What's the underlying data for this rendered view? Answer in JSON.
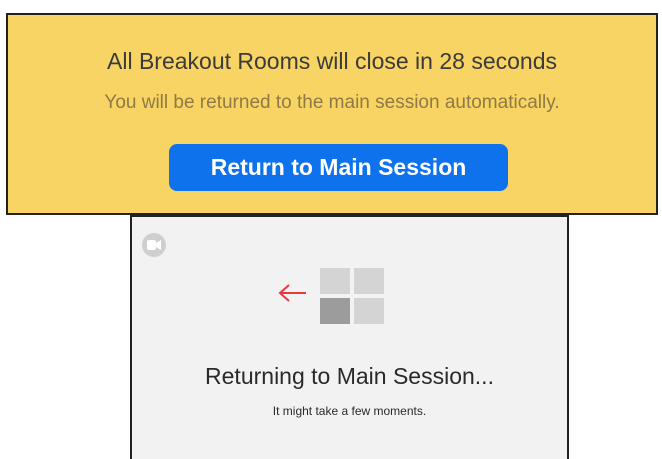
{
  "banner": {
    "title": "All Breakout Rooms will close in 28 seconds",
    "subtitle": "You will be returned to the main session automatically.",
    "button_label": "Return to Main Session",
    "colors": {
      "background": "#f7d464",
      "button": "#0e72ed"
    }
  },
  "panel": {
    "corner_icon": "video-camera-icon",
    "arrow_icon": "left-arrow-icon",
    "grid_icon": "breakout-grid-icon",
    "title": "Returning to Main Session...",
    "subtitle": "It might take a few moments.",
    "colors": {
      "background": "#f2f2f2",
      "arrow": "#e8383d"
    }
  }
}
